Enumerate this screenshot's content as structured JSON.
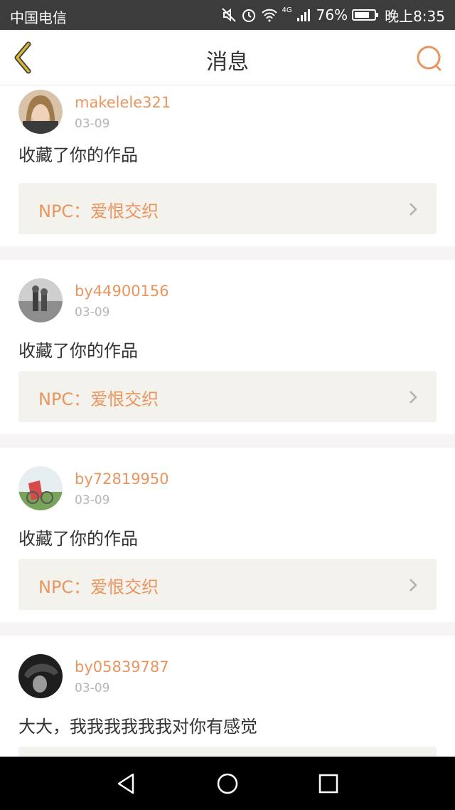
{
  "status_bar": {
    "carrier": "中国电信",
    "network": "4G",
    "battery": "76%",
    "time": "晚上8:35"
  },
  "header": {
    "title": "消息"
  },
  "messages": [
    {
      "username": "makelele321",
      "date": "03-09",
      "text": "收藏了你的作品",
      "work": "NPC：爱恨交织"
    },
    {
      "username": "by44900156",
      "date": "03-09",
      "text": "收藏了你的作品",
      "work": "NPC：爱恨交织"
    },
    {
      "username": "by72819950",
      "date": "03-09",
      "text": "收藏了你的作品",
      "work": "NPC：爱恨交织"
    },
    {
      "username": "by05839787",
      "date": "03-09",
      "text": "大大，我我我我我我对你有感觉",
      "work": ""
    }
  ],
  "colors": {
    "accent": "#e8955f",
    "back_icon": "#c6a526",
    "work_bg": "#f4f2ec"
  },
  "icons": [
    "back-icon",
    "search-icon",
    "chevron-right-icon",
    "nav-back-icon",
    "nav-home-icon",
    "nav-recents-icon"
  ]
}
